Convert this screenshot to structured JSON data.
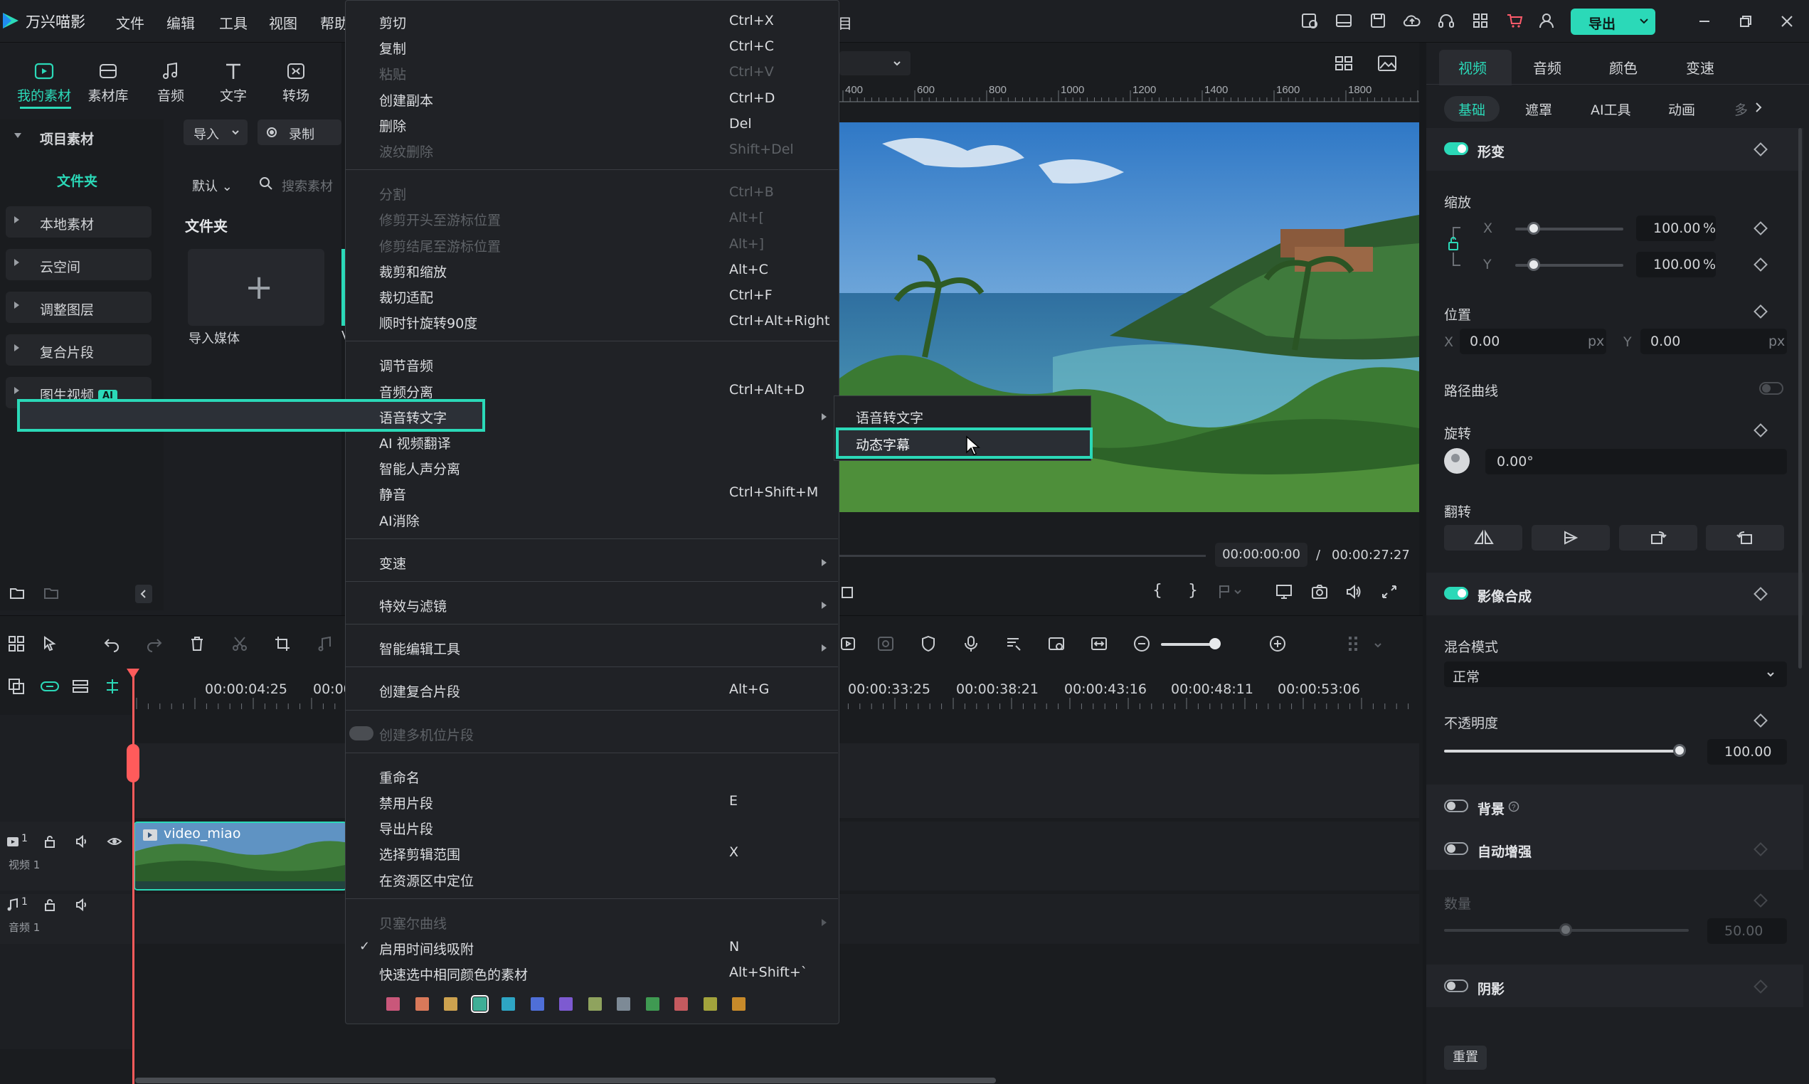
{
  "app": {
    "name": "万兴喵影"
  },
  "menubar": [
    "文件",
    "编辑",
    "工具",
    "视图",
    "帮助"
  ],
  "menubar_partial": "目",
  "export_label": "导出",
  "toolbar_tabs": [
    "我的素材",
    "素材库",
    "音频",
    "文字",
    "转场"
  ],
  "library": {
    "project_media": "项目素材",
    "folder": "文件夹",
    "items": [
      "本地素材",
      "云空间",
      "调整图层",
      "复合片段",
      "图生视频"
    ],
    "ai_badge": "AI",
    "import_label": "导入",
    "record_label": "录制",
    "sort_label": "默认",
    "search_placeholder": "搜索素材",
    "folder_heading": "文件夹",
    "import_media": "导入媒体",
    "partial_v": "V"
  },
  "preview": {
    "ruler": [
      "400",
      "600",
      "800",
      "1000",
      "1200",
      "1400",
      "1600",
      "1800"
    ],
    "current_time": "00:00:00:00",
    "separator": "/",
    "duration": "00:00:27:27",
    "brace_open": "{",
    "brace_close": "}"
  },
  "context_menu": {
    "groups": [
      [
        {
          "label": "剪切",
          "shortcut": "Ctrl+X",
          "enabled": true
        },
        {
          "label": "复制",
          "shortcut": "Ctrl+C",
          "enabled": true
        },
        {
          "label": "粘贴",
          "shortcut": "Ctrl+V",
          "enabled": false
        },
        {
          "label": "创建副本",
          "shortcut": "Ctrl+D",
          "enabled": true
        },
        {
          "label": "删除",
          "shortcut": "Del",
          "enabled": true
        },
        {
          "label": "波纹删除",
          "shortcut": "Shift+Del",
          "enabled": false
        }
      ],
      [
        {
          "label": "分割",
          "shortcut": "Ctrl+B",
          "enabled": false
        },
        {
          "label": "修剪开头至游标位置",
          "shortcut": "Alt+[",
          "enabled": false
        },
        {
          "label": "修剪结尾至游标位置",
          "shortcut": "Alt+]",
          "enabled": false
        },
        {
          "label": "裁剪和缩放",
          "shortcut": "Alt+C",
          "enabled": true
        },
        {
          "label": "裁切适配",
          "shortcut": "Ctrl+F",
          "enabled": true
        },
        {
          "label": "顺时针旋转90度",
          "shortcut": "Ctrl+Alt+Right",
          "enabled": true
        }
      ],
      [
        {
          "label": "调节音频",
          "shortcut": "",
          "enabled": true
        },
        {
          "label": "音频分离",
          "shortcut": "Ctrl+Alt+D",
          "enabled": true
        },
        {
          "label": "语音转文字",
          "shortcut": "",
          "enabled": true,
          "submenu": true
        },
        {
          "label": "AI 视频翻译",
          "shortcut": "",
          "enabled": true
        },
        {
          "label": "智能人声分离",
          "shortcut": "",
          "enabled": true
        },
        {
          "label": "静音",
          "shortcut": "Ctrl+Shift+M",
          "enabled": true
        },
        {
          "label": "AI消除",
          "shortcut": "",
          "enabled": true
        }
      ],
      [
        {
          "label": "变速",
          "shortcut": "",
          "enabled": true,
          "submenu": true
        }
      ],
      [
        {
          "label": "特效与滤镜",
          "shortcut": "",
          "enabled": true,
          "submenu": true
        }
      ],
      [
        {
          "label": "智能编辑工具",
          "shortcut": "",
          "enabled": true,
          "submenu": true
        }
      ],
      [
        {
          "label": "创建复合片段",
          "shortcut": "Alt+G",
          "enabled": true
        }
      ],
      [
        {
          "label": "创建多机位片段",
          "shortcut": "",
          "enabled": false
        }
      ],
      [
        {
          "label": "重命名",
          "shortcut": "",
          "enabled": true
        },
        {
          "label": "禁用片段",
          "shortcut": "E",
          "enabled": true
        },
        {
          "label": "导出片段",
          "shortcut": "",
          "enabled": true
        },
        {
          "label": "选择剪辑范围",
          "shortcut": "X",
          "enabled": true
        },
        {
          "label": "在资源区中定位",
          "shortcut": "",
          "enabled": true
        }
      ],
      [
        {
          "label": "贝塞尔曲线",
          "shortcut": "",
          "enabled": false,
          "submenu": true
        },
        {
          "label": "启用时间线吸附",
          "shortcut": "N",
          "enabled": true,
          "checked": true
        },
        {
          "label": "快速选中相同颜色的素材",
          "shortcut": "Alt+Shift+`",
          "enabled": true
        }
      ]
    ],
    "color_swatches": [
      "#c9577a",
      "#d9795a",
      "#cda24f",
      "#3fae96",
      "#2ea5c4",
      "#4f6fd8",
      "#7d5ad1",
      "#8fa35e",
      "#7d8a96",
      "#3f9a52",
      "#c55a5f",
      "#a2a33c",
      "#c78a2a"
    ],
    "selected_swatch": 3,
    "submenu": {
      "items": [
        "语音转文字",
        "动态字幕"
      ],
      "highlighted": 1
    }
  },
  "right_panel": {
    "tabs": [
      "视频",
      "音频",
      "颜色",
      "变速"
    ],
    "subtabs": [
      "基础",
      "遮罩",
      "AI工具",
      "动画",
      "多"
    ],
    "transform": "形变",
    "scale": "缩放",
    "scale_x_label": "X",
    "scale_y_label": "Y",
    "scale_x": "100.00",
    "scale_y": "100.00",
    "percent": "%",
    "position": "位置",
    "pos_x_label": "X",
    "pos_y_label": "Y",
    "pos_x": "0.00",
    "pos_y": "0.00",
    "px": "px",
    "path_curve": "路径曲线",
    "rotate": "旋转",
    "rotate_value": "0.00°",
    "flip": "翻转",
    "compositing": "影像合成",
    "blend_mode": "混合模式",
    "blend_value": "正常",
    "opacity": "不透明度",
    "opacity_value": "100.00",
    "background": "背景",
    "auto_enhance": "自动增强",
    "amount": "数量",
    "amount_value": "50.00",
    "shadow": "阴影",
    "reset": "重置"
  },
  "timeline": {
    "timecodes": [
      "00:00:04:25",
      "00:00",
      "00:00:33:25",
      "00:00:38:21",
      "00:00:43:16",
      "00:00:48:11",
      "00:00:53:06"
    ],
    "video_track": "视频 1",
    "audio_track": "音频 1",
    "video_track_num": "1",
    "audio_track_num": "1",
    "clip_name": "video_miao",
    "playhead_value": 0.0
  },
  "colors": {
    "accent": "#2bd9b8",
    "playhead": "#ff5b5b"
  }
}
